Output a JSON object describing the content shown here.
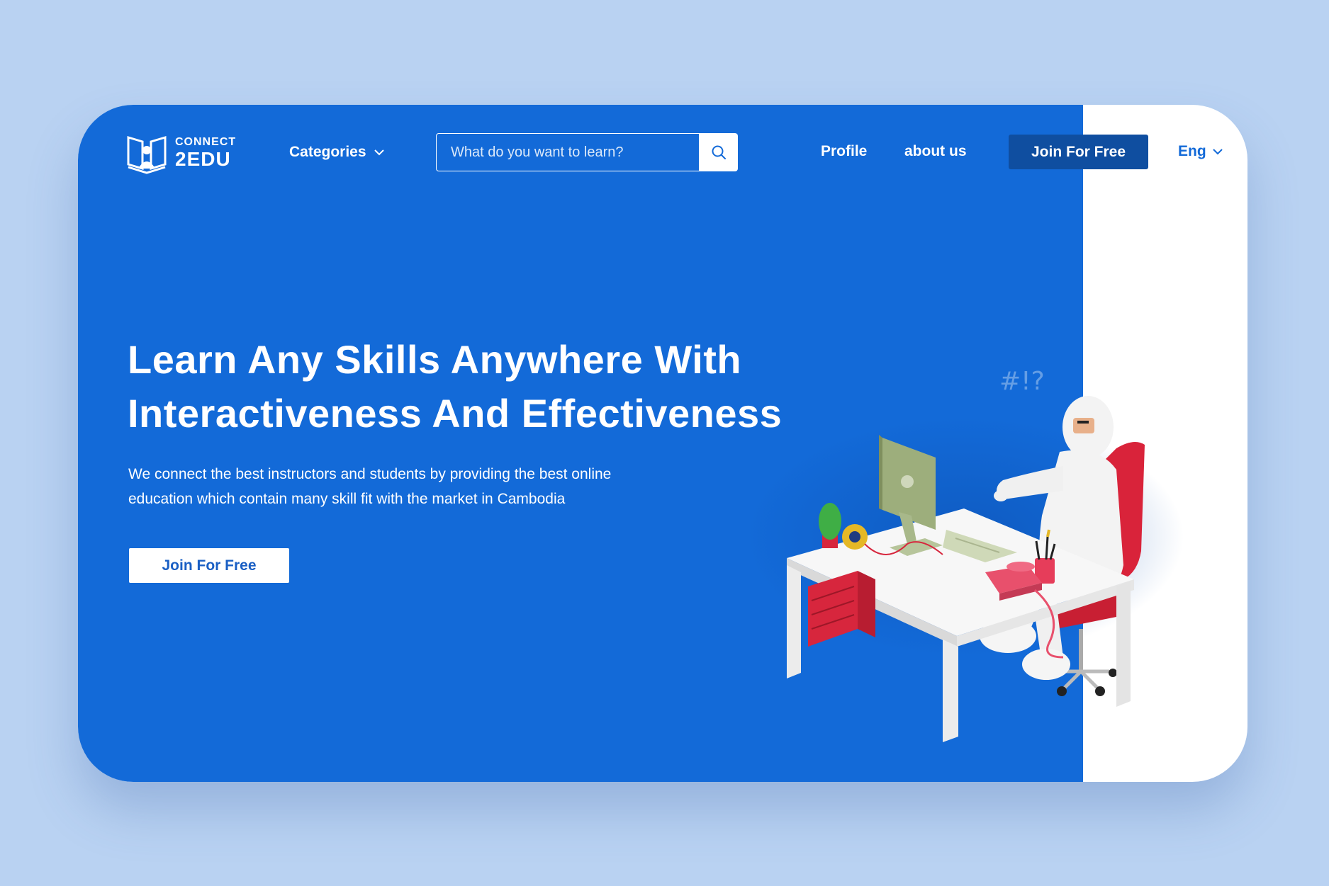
{
  "brand": {
    "line1": "CONNECT",
    "line2": "2EDU"
  },
  "nav": {
    "categories_label": "Categories",
    "search_placeholder": "What do you want to learn?",
    "profile_label": "Profile",
    "about_label": "about us",
    "join_label": "Join For Free",
    "language_label": "Eng"
  },
  "hero": {
    "headline_line1": "Learn Any Skills Anywhere With",
    "headline_line2": "Interactiveness And Effectiveness",
    "description_line1": "We connect the best instructors and students by providing the best online",
    "description_line2": "education which contain many skill fit with the market in Cambodia",
    "cta_label": "Join For Free"
  },
  "colors": {
    "page_bg": "#b9d2f2",
    "primary": "#136ad8",
    "primary_dark": "#0f4ea0",
    "white": "#ffffff"
  }
}
